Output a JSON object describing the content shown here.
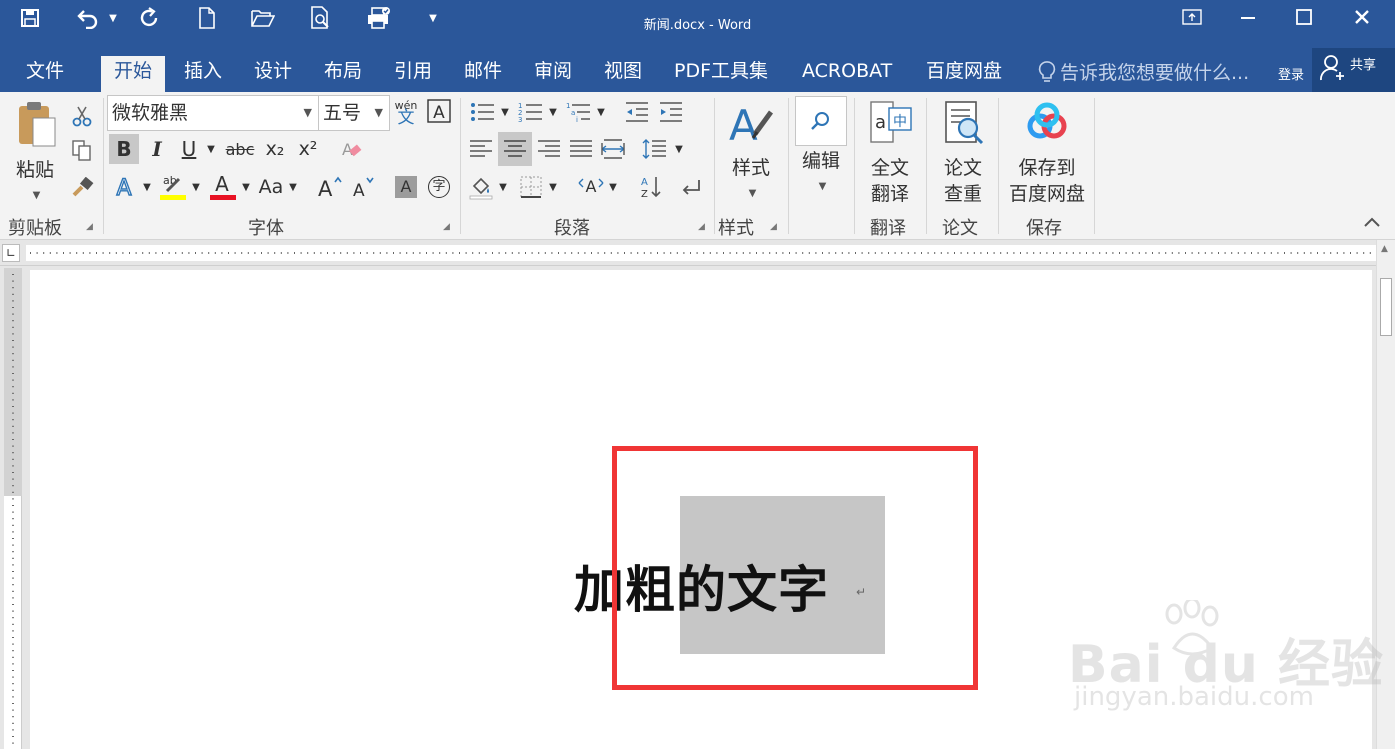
{
  "window": {
    "title": "新闻.docx - Word"
  },
  "tabs": [
    "文件",
    "开始",
    "插入",
    "设计",
    "布局",
    "引用",
    "邮件",
    "审阅",
    "视图",
    "PDF工具集",
    "ACROBAT",
    "百度网盘"
  ],
  "active_tab": "开始",
  "tell_me": "告诉我您想要做什么...",
  "login_label": "登录",
  "share_label": "共享",
  "ribbon": {
    "clipboard": {
      "paste_label": "粘贴",
      "group_label": "剪贴板"
    },
    "font": {
      "font_name": "微软雅黑",
      "font_size": "五号",
      "wen_top": "wén",
      "wen_bottom": "文",
      "bold": "B",
      "italic": "I",
      "underline": "U",
      "strike": "abc",
      "subscript": "x₂",
      "superscript": "x²",
      "case": "Aa",
      "char_shading": "A",
      "enclose": "字",
      "group_label": "字体"
    },
    "paragraph": {
      "group_label": "段落"
    },
    "styles": {
      "button_label": "样式",
      "group_label": "样式"
    },
    "editing": {
      "button_label": "编辑"
    },
    "translate": {
      "button_line1": "全文",
      "button_line2": "翻译",
      "group_label": "翻译"
    },
    "paper": {
      "button_line1": "论文",
      "button_line2": "查重",
      "group_label": "论文"
    },
    "save": {
      "button_line1": "保存到",
      "button_line2": "百度网盘",
      "group_label": "保存"
    }
  },
  "document": {
    "text_normal": "加粗",
    "text_selected": "的文字",
    "paragraph_mark": "↵"
  },
  "watermark": {
    "main": "Bai du 经验",
    "sub": "jingyan.baidu.com"
  },
  "colors": {
    "title_bar": "#2b579a",
    "highlight_bar": "#ffff00",
    "font_color_bar": "#e81123",
    "annotation_box": "#f03535",
    "selection": "#c6c6c6"
  }
}
